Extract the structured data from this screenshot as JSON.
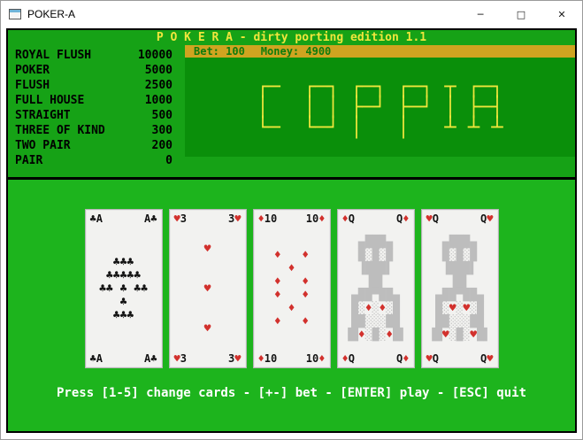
{
  "window": {
    "title": "POKER-A",
    "minimize_label": "─",
    "maximize_label": "□",
    "close_label": "✕"
  },
  "game": {
    "title": "P O K E R A - dirty porting edition 1.1",
    "status": {
      "bet": "Bet: 100",
      "money": "Money: 4900"
    },
    "paytable": [
      {
        "name": "ROYAL FLUSH",
        "value": "10000"
      },
      {
        "name": "POKER",
        "value": "5000"
      },
      {
        "name": "FLUSH",
        "value": "2500"
      },
      {
        "name": "FULL HOUSE",
        "value": "1000"
      },
      {
        "name": "STRAIGHT",
        "value": "500"
      },
      {
        "name": "THREE OF KIND",
        "value": "300"
      },
      {
        "name": "TWO PAIR",
        "value": "200"
      },
      {
        "name": "PAIR",
        "value": "0"
      }
    ],
    "hand_result": {
      "text": "COPPIA",
      "art": [
        "┌─  ┌─┐ ┌─┐ ┌─┐ ┬ ┌─┐",
        "│   │ │ ├─┘ ├─┘ │ ├─┤",
        "└─  └─┘ │   │   ┴ ┴ ┴"
      ]
    },
    "cards": [
      {
        "id": "ace-of-clubs",
        "rank": "A",
        "suit": "♣",
        "color": "black",
        "corners": {
          "tl": "♣A",
          "tr": "A♣",
          "bl": "♣A",
          "br": "A♣"
        },
        "art": [
          "  ♣♣♣  ",
          " ♣♣♣♣♣ ",
          "♣♣ ♣ ♣♣",
          "   ♣   ",
          "  ♣♣♣  "
        ]
      },
      {
        "id": "three-of-hearts",
        "rank": "3",
        "suit": "♥",
        "color": "red",
        "corners": {
          "tl": "♥3",
          "tr": "3♥",
          "bl": "♥3",
          "br": "3♥"
        },
        "art": [
          "  ♥  ",
          "",
          "",
          "  ♥  ",
          "",
          "",
          "  ♥  "
        ]
      },
      {
        "id": "ten-of-diamonds",
        "rank": "10",
        "suit": "♦",
        "color": "red",
        "corners": {
          "tl": "♦10",
          "tr": "10♦",
          "bl": "♦10",
          "br": "10♦"
        },
        "art": [
          "♦   ♦",
          "  ♦  ",
          "♦   ♦",
          "♦   ♦",
          "  ♦  ",
          "♦   ♦"
        ]
      },
      {
        "id": "queen-of-diamonds",
        "rank": "Q",
        "suit": "♦",
        "color": "red",
        "corners": {
          "tl": "♦Q",
          "tr": "Q♦",
          "bl": "♦Q",
          "br": "Q♦"
        },
        "art": [
          "  ▄███▄  ",
          "  █░█░█  ",
          "  ▐███▌  ",
          "   ▐█▌   ",
          " ▄██▀██▄ ",
          " █░♦░♦░█ ",
          " ██░░░██ ",
          "▐█♦░█░♦█▌"
        ]
      },
      {
        "id": "queen-of-hearts",
        "rank": "Q",
        "suit": "♥",
        "color": "red",
        "corners": {
          "tl": "♥Q",
          "tr": "Q♥",
          "bl": "♥Q",
          "br": "Q♥"
        },
        "art": [
          "  ▄███▄  ",
          "  █░█░█  ",
          "  ▐███▌  ",
          "   ▐█▌   ",
          " ▄██▀██▄ ",
          " █░♥░♥░█ ",
          " ██░░░██ ",
          "▐█♥░█░♥█▌"
        ]
      }
    ],
    "instructions": "Press [1-5] change cards - [+-] bet - [ENTER] play - [ESC] quit"
  },
  "colors": {
    "green_top": "#16A216",
    "green_main": "#1DB41D",
    "green_dark": "#0A8F0A",
    "gold": "#CFA420",
    "yellow": "#F0E63C",
    "status_text": "#0E7C0E",
    "red": "#D2312D",
    "black": "#141414",
    "grey": "#BDBDBD"
  }
}
